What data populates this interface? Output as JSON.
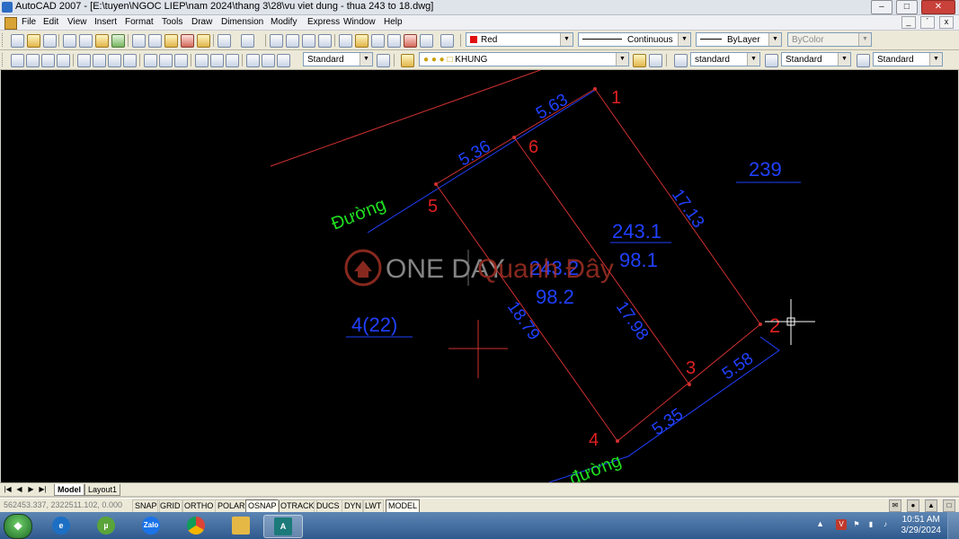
{
  "window": {
    "title": "AutoCAD 2007 - [E:\\tuyen\\NGOC LIEP\\nam 2024\\thang 3\\28\\vu viet dung - thua 243 to 18.dwg]",
    "min_glyph": "–",
    "max_glyph": "□",
    "close_glyph": "✕"
  },
  "menu": {
    "items": [
      "File",
      "Edit",
      "View",
      "Insert",
      "Format",
      "Tools",
      "Draw",
      "Dimension",
      "Modify",
      "Express",
      "Window",
      "Help"
    ],
    "mdi": [
      "_",
      "´",
      "x"
    ]
  },
  "toolbar": {
    "color_value": "Red",
    "color_hex": "#e01010",
    "linetype_value": "Continuous",
    "lineweight_value": "ByLayer",
    "plotstyle_value": "ByColor",
    "dimstyle_value": "Standard",
    "layer_value": "KHUNG",
    "textstyle_value": "standard",
    "tablestyle_value": "Standard",
    "mleaderstyle_value": "Standard",
    "dropdown_arrow": "▼"
  },
  "drawing": {
    "point_labels": [
      "1",
      "2",
      "3",
      "4",
      "5",
      "6"
    ],
    "dimensions": [
      "5.63",
      "5.36",
      "17.13",
      "18.79",
      "17.98",
      "5.58",
      "5.35"
    ],
    "parcels": [
      {
        "number": "243.1",
        "area": "98.1"
      },
      {
        "number": "243.2",
        "area": "98.2"
      },
      {
        "number": "239",
        "area": ""
      },
      {
        "number": "4(22)",
        "area": ""
      }
    ],
    "road_labels": [
      "Đường",
      "đường"
    ],
    "watermark": {
      "brand": "ONE DAY",
      "site": "Quanh Đây"
    },
    "colors": {
      "boundary": "#d03030",
      "dimension": "#2040ff",
      "point": "#e02020",
      "road": "#20e020",
      "background": "#000000"
    }
  },
  "layout_tabs": {
    "nav": [
      "|◀",
      "◀",
      "▶",
      "▶|"
    ],
    "tabs": [
      "Model",
      "Layout1"
    ]
  },
  "status": {
    "coordinates": "562453.337, 2322511.102, 0.000",
    "toggles": [
      "SNAP",
      "GRID",
      "ORTHO",
      "POLAR",
      "OSNAP",
      "OTRACK",
      "DUCS",
      "DYN",
      "LWT",
      "MODEL"
    ],
    "active_toggles": [
      "OSNAP",
      "MODEL"
    ]
  },
  "taskbar": {
    "start_glyph": "❖",
    "apps": [
      "internet-explorer",
      "utorrent",
      "zalo",
      "chrome",
      "file-explorer",
      "autocad"
    ],
    "app_labels": {
      "zalo": "Zalo",
      "autocad": "A"
    },
    "tray_arrow": "▲",
    "time": "10:51 AM",
    "date": "3/29/2024"
  }
}
